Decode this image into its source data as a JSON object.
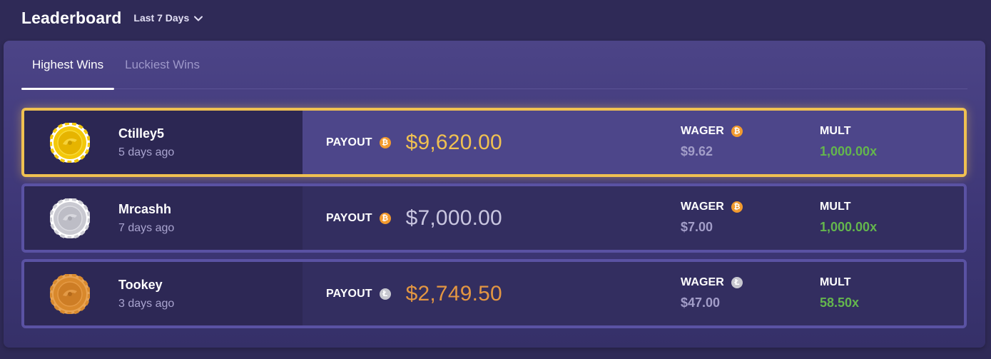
{
  "header": {
    "title": "Leaderboard",
    "range_label": "Last 7 Days"
  },
  "tabs": [
    {
      "label": "Highest Wins",
      "active": true
    },
    {
      "label": "Luckiest Wins",
      "active": false
    }
  ],
  "labels": {
    "payout": "PAYOUT",
    "wager": "WAGER",
    "mult": "MULT"
  },
  "rows": [
    {
      "rank_medal": "gold",
      "name": "Ctilley5",
      "time_ago": "5 days ago",
      "payout": "$9,620.00",
      "payout_color": "#f0c151",
      "currency": "btc",
      "wager": "$9.62",
      "mult": "1,000.00x"
    },
    {
      "rank_medal": "silver",
      "name": "Mrcashh",
      "time_ago": "7 days ago",
      "payout": "$7,000.00",
      "payout_color": "#c9c6e0",
      "currency": "btc",
      "wager": "$7.00",
      "mult": "1,000.00x"
    },
    {
      "rank_medal": "bronze",
      "name": "Tookey",
      "time_ago": "3 days ago",
      "payout": "$2,749.50",
      "payout_color": "#e39642",
      "currency": "ltc",
      "wager": "$47.00",
      "mult": "58.50x"
    }
  ],
  "colors": {
    "background": "#2f2a57",
    "gold_border": "#f0c151",
    "mult_green": "#64b64d",
    "btc": "#f29a2e",
    "ltc": "#c7c7cf"
  }
}
